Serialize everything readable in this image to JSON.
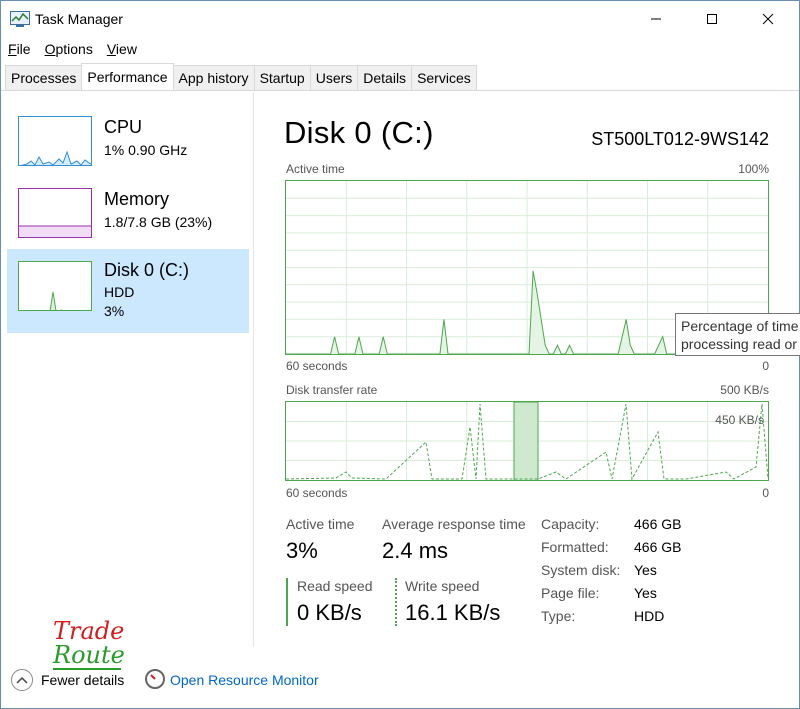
{
  "window": {
    "title": "Task Manager"
  },
  "menu": [
    {
      "key": "F",
      "rest": "ile"
    },
    {
      "key": "O",
      "rest": "ptions"
    },
    {
      "key": "V",
      "rest": "iew"
    }
  ],
  "tabs": [
    "Processes",
    "Performance",
    "App history",
    "Startup",
    "Users",
    "Details",
    "Services"
  ],
  "active_tab": "Performance",
  "sidebar": {
    "items": [
      {
        "title": "CPU",
        "line1": "1%  0.90 GHz",
        "line2": "",
        "color": "#2f8fd8"
      },
      {
        "title": "Memory",
        "line1": "1.8/7.8 GB (23%)",
        "line2": "",
        "color": "#9b2fae"
      },
      {
        "title": "Disk 0 (C:)",
        "line1": "HDD",
        "line2": "3%",
        "color": "#4ca84c",
        "selected": true
      }
    ]
  },
  "main": {
    "title": "Disk 0 (C:)",
    "model": "ST500LT012-9WS142",
    "active_chart": {
      "label": "Active time",
      "max_label": "100%",
      "x_label": "60 seconds",
      "min_label": "0",
      "values_percent": [
        0,
        0,
        0,
        0,
        0,
        0,
        0,
        0,
        0,
        0,
        0,
        0,
        10,
        0,
        0,
        0,
        0,
        0,
        10,
        0,
        0,
        0,
        0,
        0,
        10,
        0,
        0,
        0,
        0,
        0,
        0,
        0,
        0,
        0,
        0,
        0,
        0,
        0,
        0,
        20,
        0,
        0,
        0,
        0,
        0,
        0,
        0,
        0,
        0,
        0,
        0,
        0,
        0,
        0,
        0,
        0,
        0,
        0,
        0,
        0,
        0,
        48,
        35,
        20,
        5,
        0,
        0,
        5,
        0,
        0,
        5,
        0,
        0,
        0,
        0,
        0,
        0,
        0,
        0,
        0,
        0,
        0,
        0,
        10,
        20,
        5,
        0,
        0,
        0,
        0,
        0,
        0,
        5,
        10,
        0,
        0,
        0,
        0,
        0,
        10,
        0,
        0,
        0,
        0,
        0,
        0,
        0,
        0,
        0,
        5,
        0,
        0,
        0,
        0,
        0,
        0,
        0,
        10,
        17,
        0
      ]
    },
    "transfer_chart": {
      "label": "Disk transfer rate",
      "max_label": "500 KB/s",
      "scale_label": "450 KB/s",
      "x_label": "60 seconds",
      "min_label": "0"
    },
    "tooltip": "Percentage of time the disk is processing read or write requests",
    "tooltip_line1": "Percentage of time",
    "tooltip_line2": "processing read or",
    "stats": {
      "active_time_label": "Active time",
      "active_time_value": "3%",
      "response_label": "Average response time",
      "response_value": "2.4 ms",
      "read_label": "Read speed",
      "read_value": "0 KB/s",
      "write_label": "Write speed",
      "write_value": "16.1 KB/s"
    },
    "properties": [
      {
        "label": "Capacity:",
        "value": "466 GB"
      },
      {
        "label": "Formatted:",
        "value": "466 GB"
      },
      {
        "label": "System disk:",
        "value": "Yes"
      },
      {
        "label": "Page file:",
        "value": "Yes"
      },
      {
        "label": "Type:",
        "value": "HDD"
      }
    ]
  },
  "footer": {
    "fewer_details": "Fewer details",
    "open_monitor": "Open Resource Monitor"
  },
  "watermark": {
    "line1": "Trade",
    "line2": "Route"
  },
  "colors": {
    "accent_green": "#4ca84c",
    "selected_bg": "#cce8ff",
    "link": "#0066cc"
  }
}
